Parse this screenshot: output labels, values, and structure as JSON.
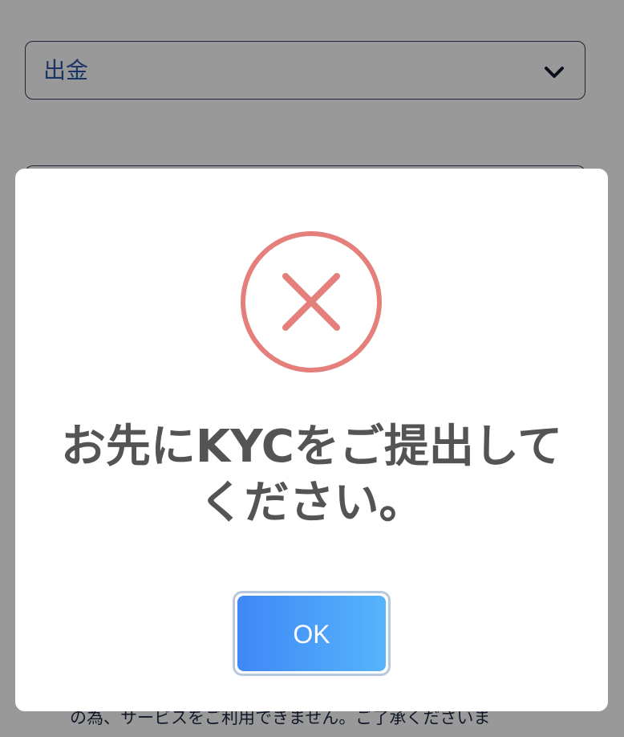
{
  "background": {
    "select": {
      "value": "出金",
      "chevron_icon": "chevron-down-icon"
    },
    "notice_text": "の為、サービスをご利用できません。ご了承くださいま"
  },
  "modal": {
    "icon": "error-x-icon",
    "icon_color": "#e57f7c",
    "message": "お先にKYCをご提出してください。",
    "ok_label": "OK",
    "ok_color_start": "#3f88f7",
    "ok_color_end": "#56b4fc"
  }
}
